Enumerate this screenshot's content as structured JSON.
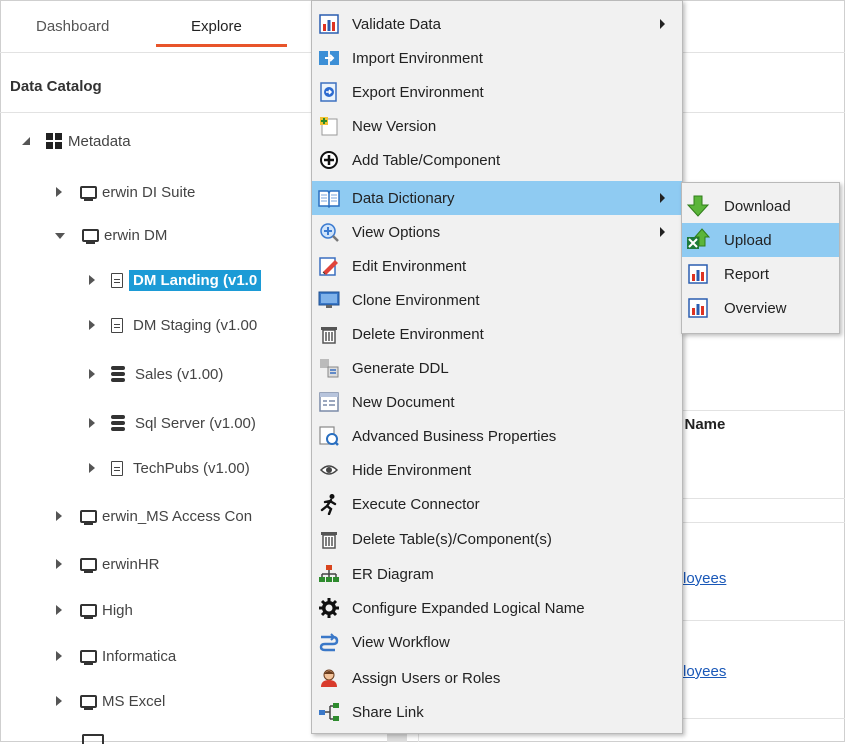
{
  "tabs": [
    {
      "label": "Dashboard",
      "active": false
    },
    {
      "label": "Explore",
      "active": true
    }
  ],
  "catalog": {
    "title": "Data Catalog",
    "tree": [
      {
        "label": "Metadata",
        "icon": "grid-icon",
        "expanded": true,
        "level": 0
      },
      {
        "label": "erwin DI Suite",
        "icon": "monitor-icon",
        "expanded": false,
        "level": 1
      },
      {
        "label": "erwin DM",
        "icon": "monitor-icon",
        "expanded": true,
        "level": 1
      },
      {
        "label": "DM Landing (v1.0",
        "icon": "document-icon",
        "expanded": false,
        "level": 2,
        "selected": true
      },
      {
        "label": "DM Staging (v1.00",
        "icon": "document-icon",
        "expanded": false,
        "level": 2
      },
      {
        "label": "Sales (v1.00)",
        "icon": "database-icon",
        "expanded": false,
        "level": 2
      },
      {
        "label": "Sql Server (v1.00)",
        "icon": "database-icon",
        "expanded": false,
        "level": 2
      },
      {
        "label": "TechPubs (v1.00)",
        "icon": "document-icon",
        "expanded": false,
        "level": 2
      },
      {
        "label": "erwin_MS Access Con",
        "icon": "monitor-icon",
        "expanded": false,
        "level": 1
      },
      {
        "label": "erwinHR",
        "icon": "monitor-icon",
        "expanded": false,
        "level": 1
      },
      {
        "label": "High",
        "icon": "monitor-icon",
        "expanded": false,
        "level": 1
      },
      {
        "label": "Informatica",
        "icon": "monitor-icon",
        "expanded": false,
        "level": 1
      },
      {
        "label": "MS Excel",
        "icon": "monitor-icon",
        "expanded": false,
        "level": 1
      }
    ]
  },
  "right_panel": {
    "column_header": "e Name",
    "links": [
      "loyees",
      "loyees"
    ]
  },
  "context_menu": {
    "items": [
      {
        "label": "Validate Data",
        "icon": "chart-icon",
        "submenu": true
      },
      {
        "label": "Import Environment",
        "icon": "import-icon",
        "submenu": false
      },
      {
        "label": "Export Environment",
        "icon": "export-icon",
        "submenu": false
      },
      {
        "label": "New Version",
        "icon": "new-version-icon",
        "submenu": false
      },
      {
        "label": "Add Table/Component",
        "icon": "add-circle-icon",
        "submenu": false
      },
      {
        "label": "Data Dictionary",
        "icon": "book-icon",
        "submenu": true,
        "selected": true
      },
      {
        "label": "View Options",
        "icon": "view-options-icon",
        "submenu": true
      },
      {
        "label": "Edit Environment",
        "icon": "edit-icon",
        "submenu": false
      },
      {
        "label": "Clone Environment",
        "icon": "clone-icon",
        "submenu": false
      },
      {
        "label": "Delete Environment",
        "icon": "trash-icon",
        "submenu": false
      },
      {
        "label": "Generate DDL",
        "icon": "generate-ddl-icon",
        "submenu": false
      },
      {
        "label": "New Document",
        "icon": "new-document-icon",
        "submenu": false
      },
      {
        "label": "Advanced Business Properties",
        "icon": "properties-icon",
        "submenu": false
      },
      {
        "label": "Hide Environment",
        "icon": "eye-icon",
        "submenu": false
      },
      {
        "label": "Execute Connector",
        "icon": "run-icon",
        "submenu": false
      },
      {
        "label": "Delete Table(s)/Component(s)",
        "icon": "trash-icon",
        "submenu": false
      },
      {
        "label": "ER Diagram",
        "icon": "er-diagram-icon",
        "submenu": false
      },
      {
        "label": "Configure Expanded Logical Name",
        "icon": "gear-icon",
        "submenu": false
      },
      {
        "label": "View Workflow",
        "icon": "workflow-icon",
        "submenu": false
      },
      {
        "label": "Assign Users or Roles",
        "icon": "user-icon",
        "submenu": false
      },
      {
        "label": "Share Link",
        "icon": "share-icon",
        "submenu": false
      }
    ]
  },
  "submenu": {
    "items": [
      {
        "label": "Download",
        "icon": "download-icon",
        "selected": false
      },
      {
        "label": "Upload",
        "icon": "upload-icon",
        "selected": true
      },
      {
        "label": "Report",
        "icon": "chart-icon",
        "selected": false
      },
      {
        "label": "Overview",
        "icon": "chart-icon",
        "selected": false
      }
    ]
  },
  "colors": {
    "accent": "#e8542a",
    "selection": "#1c9bd6",
    "menu_highlight": "#8fcbf2",
    "link": "#1a58b8"
  }
}
